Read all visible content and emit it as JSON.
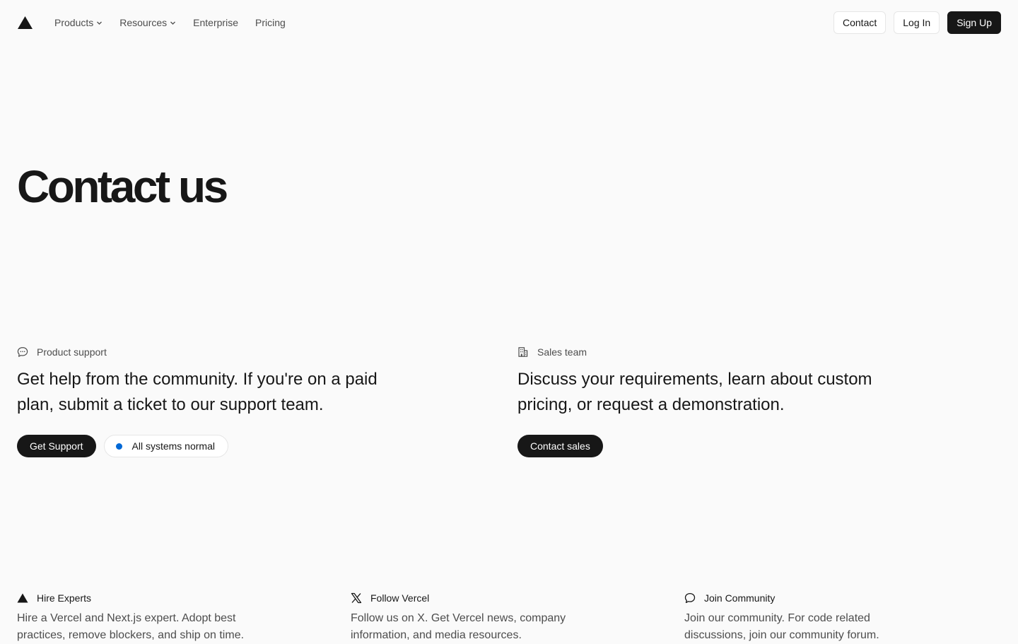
{
  "nav": {
    "items": [
      {
        "label": "Products",
        "dropdown": true
      },
      {
        "label": "Resources",
        "dropdown": true
      },
      {
        "label": "Enterprise",
        "dropdown": false
      },
      {
        "label": "Pricing",
        "dropdown": false
      }
    ],
    "contact_label": "Contact",
    "login_label": "Log In",
    "signup_label": "Sign Up"
  },
  "hero": {
    "title": "Contact us"
  },
  "support": {
    "heading": "Product support",
    "icon": "chat-bubble-icon",
    "text": "Get help from the community. If you're on a paid plan, submit a ticket to our support team.",
    "button_label": "Get Support",
    "status_label": "All systems normal",
    "status_color": "#0068d6"
  },
  "sales": {
    "heading": "Sales team",
    "icon": "building-icon",
    "text": "Discuss your requirements, learn about custom pricing, or request a demonstration.",
    "button_label": "Contact sales"
  },
  "columns": [
    {
      "heading": "Hire Experts",
      "icon": "triangle-logo-icon",
      "text": "Hire a Vercel and Next.js expert. Adopt best practices, remove blockers, and ship on time."
    },
    {
      "heading": "Follow Vercel",
      "icon": "x-logo-icon",
      "text": "Follow us on X. Get Vercel news, company information, and media resources."
    },
    {
      "heading": "Join Community",
      "icon": "speech-bubble-icon",
      "text": "Join our community. For code related discussions, join our community forum."
    }
  ],
  "colors": {
    "background": "#fafafa",
    "text": "#171717",
    "muted": "#4d4d4d",
    "accent": "#0068d6"
  }
}
